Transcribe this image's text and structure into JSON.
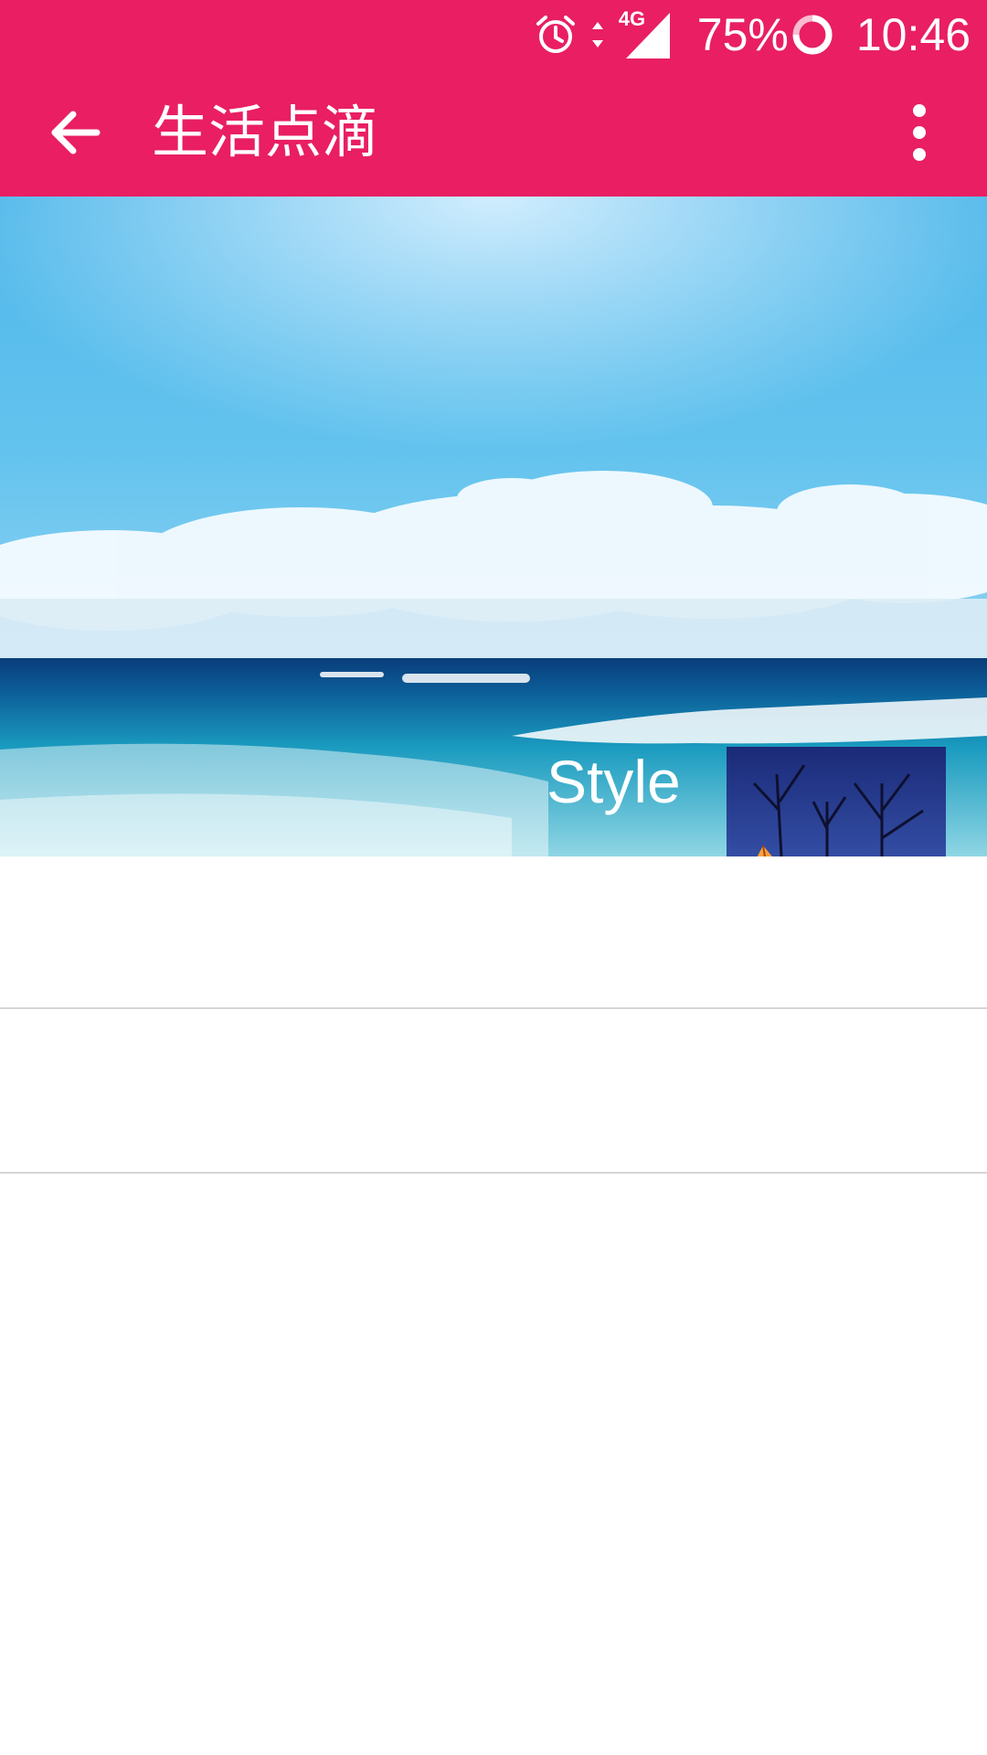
{
  "status_bar": {
    "battery": "75%",
    "time": "10:46",
    "network": "4G",
    "icons": [
      "alarm-icon",
      "data-arrows-icon",
      "signal-icon",
      "battery-ring-icon"
    ]
  },
  "toolbar": {
    "title": "生活点滴",
    "back_icon": "arrow-back-icon",
    "overflow_icon": "more-vert-icon"
  },
  "hero": {
    "caption": "Style",
    "scene": "ocean-and-sky",
    "thumbnail_scene": "night-camping-tent"
  },
  "list": {
    "rows": [
      {
        "text": ""
      },
      {
        "text": ""
      }
    ]
  },
  "colors": {
    "primary": "#e91e63",
    "on_primary": "#ffffff",
    "divider": "#d6d6d6"
  }
}
